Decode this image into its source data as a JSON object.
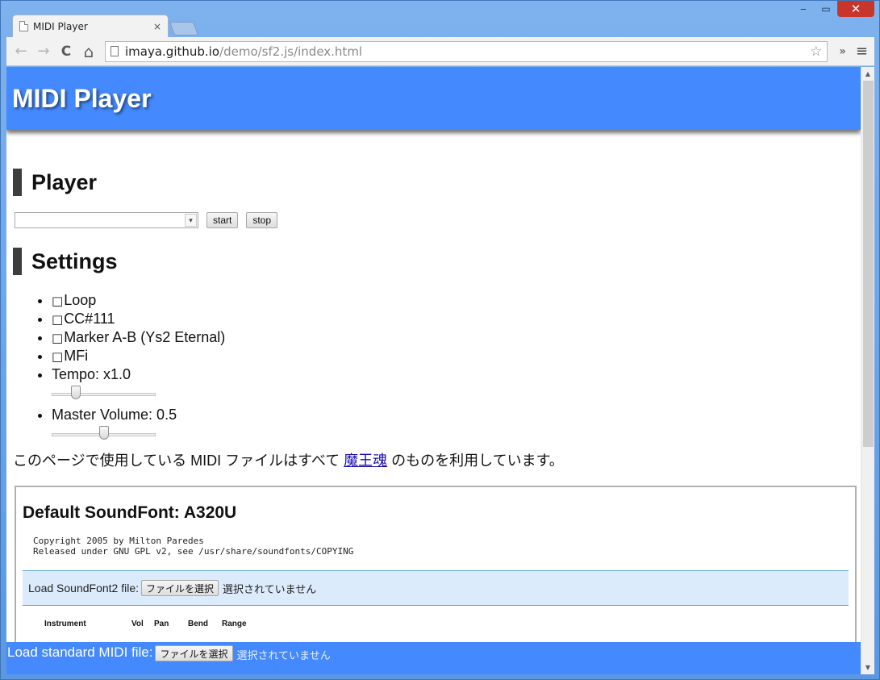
{
  "window": {
    "minimize_glyph": "‒",
    "maximize_glyph": "▭",
    "close_glyph": "✕"
  },
  "tab": {
    "title": "MIDI Player",
    "close_glyph": "×"
  },
  "toolbar": {
    "back_glyph": "←",
    "forward_glyph": "→",
    "reload_glyph": "C",
    "home_glyph": "⌂",
    "url_host": "imaya.github.io",
    "url_path": "/demo/sf2.js/index.html",
    "star_glyph": "☆",
    "extensions_glyph": "»",
    "menu_glyph": "≡"
  },
  "scrollbar": {
    "up_glyph": "▲",
    "down_glyph": "▼"
  },
  "header": {
    "title": "MIDI Player"
  },
  "player": {
    "heading": "Player",
    "select_value": "",
    "select_arrow": "▾",
    "start_label": "start",
    "stop_label": "stop"
  },
  "settings": {
    "heading": "Settings",
    "checkbox_glyph": "□",
    "loop_label": "Loop",
    "cc111_label": "CC#111",
    "marker_label": "Marker A-B (Ys2 Eternal)",
    "mfi_label": "MFi",
    "tempo_label": "Tempo: x1.0",
    "tempo_value": 1.0,
    "tempo_slider_fraction": 0.2,
    "volume_label": "Master Volume: 0.5",
    "volume_value": 0.5,
    "volume_slider_fraction": 0.5
  },
  "note": {
    "before_link": "このページで使用している MIDI ファイルはすべて ",
    "link_text": "魔王魂",
    "after_link": " のものを利用しています。"
  },
  "soundfont": {
    "title": "Default SoundFont: A320U",
    "copyright_line1": "Copyright 2005 by Milton Paredes",
    "copyright_line2": "Released under GNU GPL v2, see /usr/share/soundfonts/COPYING",
    "load_label": "Load SoundFont2 file:",
    "file_button": "ファイルを選択",
    "file_status": "選択されていません",
    "columns": [
      "Instrument",
      "Vol",
      "Pan",
      "Bend",
      "Range"
    ]
  },
  "footer": {
    "label": "Load standard MIDI file:",
    "file_button": "ファイルを選択",
    "file_status": "選択されていません"
  },
  "colors": {
    "header_blue": "#4489fd",
    "load_panel_bg": "#dcebfb",
    "link": "#1a0dab"
  }
}
